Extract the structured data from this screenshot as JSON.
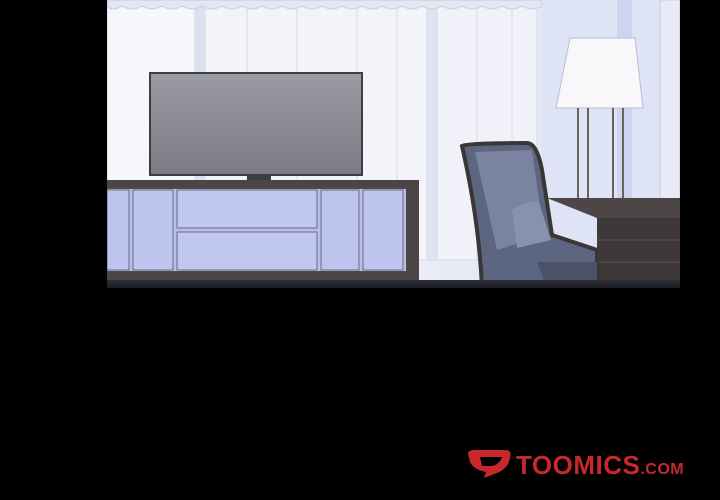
{
  "panel": {
    "description_colors": {
      "background": "#000000",
      "wall": "#e9ecf6",
      "curtain": "#f4f5fb",
      "cabinet": "#b9c1ec",
      "tv_screen": "#8d8e96",
      "desk": "#4e4646",
      "chair": "#6b7590"
    }
  },
  "watermark": {
    "brand": "TOOMICS",
    "suffix": ".COM",
    "logo_icon": "toomics-logo-icon",
    "color": "#c8282c"
  }
}
